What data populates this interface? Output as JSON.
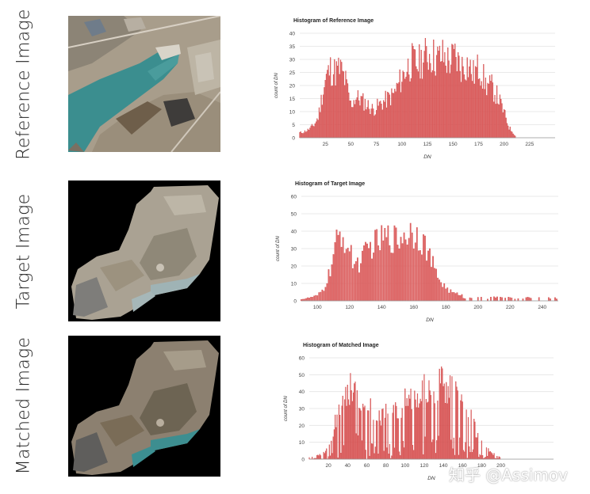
{
  "rows": [
    {
      "label": "Reference Image"
    },
    {
      "label": "Target Image"
    },
    {
      "label": "Matched Image"
    }
  ],
  "colors": {
    "bar": "#e06666",
    "bar_stroke": "#cc3b3b",
    "grid": "#e3e3e3",
    "axis": "#444444",
    "water": "#3b8e8f",
    "land": "#a79d8e"
  },
  "watermark": "知乎 @Assimov",
  "chart_data": [
    {
      "type": "bar",
      "title": "Histogram of Reference Image",
      "xlabel": "DN",
      "ylabel": "count of DN",
      "xlim": [
        0,
        250
      ],
      "ylim": [
        0,
        40
      ],
      "xticks": [
        25,
        50,
        75,
        100,
        125,
        150,
        175,
        200,
        225
      ],
      "yticks": [
        0,
        5,
        10,
        15,
        20,
        25,
        30,
        35,
        40
      ],
      "grid": true,
      "profile": [
        [
          2,
          2
        ],
        [
          8,
          3
        ],
        [
          14,
          5
        ],
        [
          18,
          8
        ],
        [
          22,
          17
        ],
        [
          26,
          24
        ],
        [
          30,
          27
        ],
        [
          34,
          26
        ],
        [
          40,
          27
        ],
        [
          45,
          22
        ],
        [
          50,
          13
        ],
        [
          55,
          16
        ],
        [
          60,
          15
        ],
        [
          66,
          13
        ],
        [
          72,
          11
        ],
        [
          78,
          13
        ],
        [
          85,
          15
        ],
        [
          92,
          17
        ],
        [
          98,
          22
        ],
        [
          104,
          27
        ],
        [
          110,
          30
        ],
        [
          116,
          29
        ],
        [
          122,
          32
        ],
        [
          128,
          33
        ],
        [
          134,
          31
        ],
        [
          140,
          32
        ],
        [
          146,
          30
        ],
        [
          152,
          32
        ],
        [
          158,
          28
        ],
        [
          164,
          29
        ],
        [
          170,
          25
        ],
        [
          176,
          28
        ],
        [
          182,
          21
        ],
        [
          188,
          20
        ],
        [
          194,
          16
        ],
        [
          200,
          10
        ],
        [
          205,
          4
        ],
        [
          209,
          2
        ],
        [
          212,
          0
        ]
      ]
    },
    {
      "type": "bar",
      "title": "Histogram of Target Image",
      "xlabel": "DN",
      "ylabel": "count of DN",
      "xlim": [
        90,
        250
      ],
      "ylim": [
        0,
        60
      ],
      "xticks": [
        100,
        120,
        140,
        160,
        180,
        200,
        220,
        240
      ],
      "yticks": [
        0,
        10,
        20,
        30,
        40,
        50,
        60
      ],
      "grid": true,
      "profile": [
        [
          91,
          1
        ],
        [
          96,
          2
        ],
        [
          100,
          3
        ],
        [
          104,
          7
        ],
        [
          108,
          18
        ],
        [
          112,
          34
        ],
        [
          115,
          40
        ],
        [
          118,
          34
        ],
        [
          122,
          24
        ],
        [
          126,
          22
        ],
        [
          130,
          28
        ],
        [
          134,
          33
        ],
        [
          138,
          35
        ],
        [
          142,
          37
        ],
        [
          146,
          38
        ],
        [
          150,
          36
        ],
        [
          154,
          40
        ],
        [
          158,
          41
        ],
        [
          162,
          41
        ],
        [
          166,
          35
        ],
        [
          170,
          26
        ],
        [
          174,
          16
        ],
        [
          178,
          10
        ],
        [
          182,
          6
        ],
        [
          186,
          4
        ],
        [
          190,
          4
        ],
        [
          195,
          3
        ],
        [
          200,
          2
        ],
        [
          206,
          2
        ],
        [
          212,
          2
        ],
        [
          218,
          1
        ],
        [
          226,
          1
        ],
        [
          236,
          1
        ],
        [
          249,
          1
        ]
      ]
    },
    {
      "type": "bar",
      "title": "Histogram of Matched Image",
      "xlabel": "DN",
      "ylabel": "count of DN",
      "xlim": [
        0,
        255
      ],
      "ylim": [
        0,
        60
      ],
      "xticks": [
        20,
        40,
        60,
        80,
        100,
        120,
        140,
        160,
        180,
        200
      ],
      "yticks": [
        0,
        10,
        20,
        30,
        40,
        50,
        60
      ],
      "grid": true,
      "profile": [
        [
          2,
          1
        ],
        [
          8,
          2
        ],
        [
          14,
          3
        ],
        [
          20,
          7
        ],
        [
          26,
          20
        ],
        [
          32,
          32
        ],
        [
          38,
          38
        ],
        [
          44,
          44
        ],
        [
          48,
          46
        ],
        [
          52,
          40
        ],
        [
          58,
          34
        ],
        [
          64,
          30
        ],
        [
          70,
          28
        ],
        [
          76,
          27
        ],
        [
          82,
          28
        ],
        [
          88,
          29
        ],
        [
          94,
          32
        ],
        [
          100,
          36
        ],
        [
          106,
          39
        ],
        [
          112,
          42
        ],
        [
          118,
          41
        ],
        [
          124,
          42
        ],
        [
          130,
          43
        ],
        [
          136,
          45
        ],
        [
          142,
          46
        ],
        [
          148,
          42
        ],
        [
          154,
          40
        ],
        [
          160,
          36
        ],
        [
          166,
          28
        ],
        [
          172,
          20
        ],
        [
          178,
          12
        ],
        [
          184,
          7
        ],
        [
          190,
          4
        ],
        [
          196,
          2
        ],
        [
          200,
          1
        ]
      ]
    }
  ]
}
